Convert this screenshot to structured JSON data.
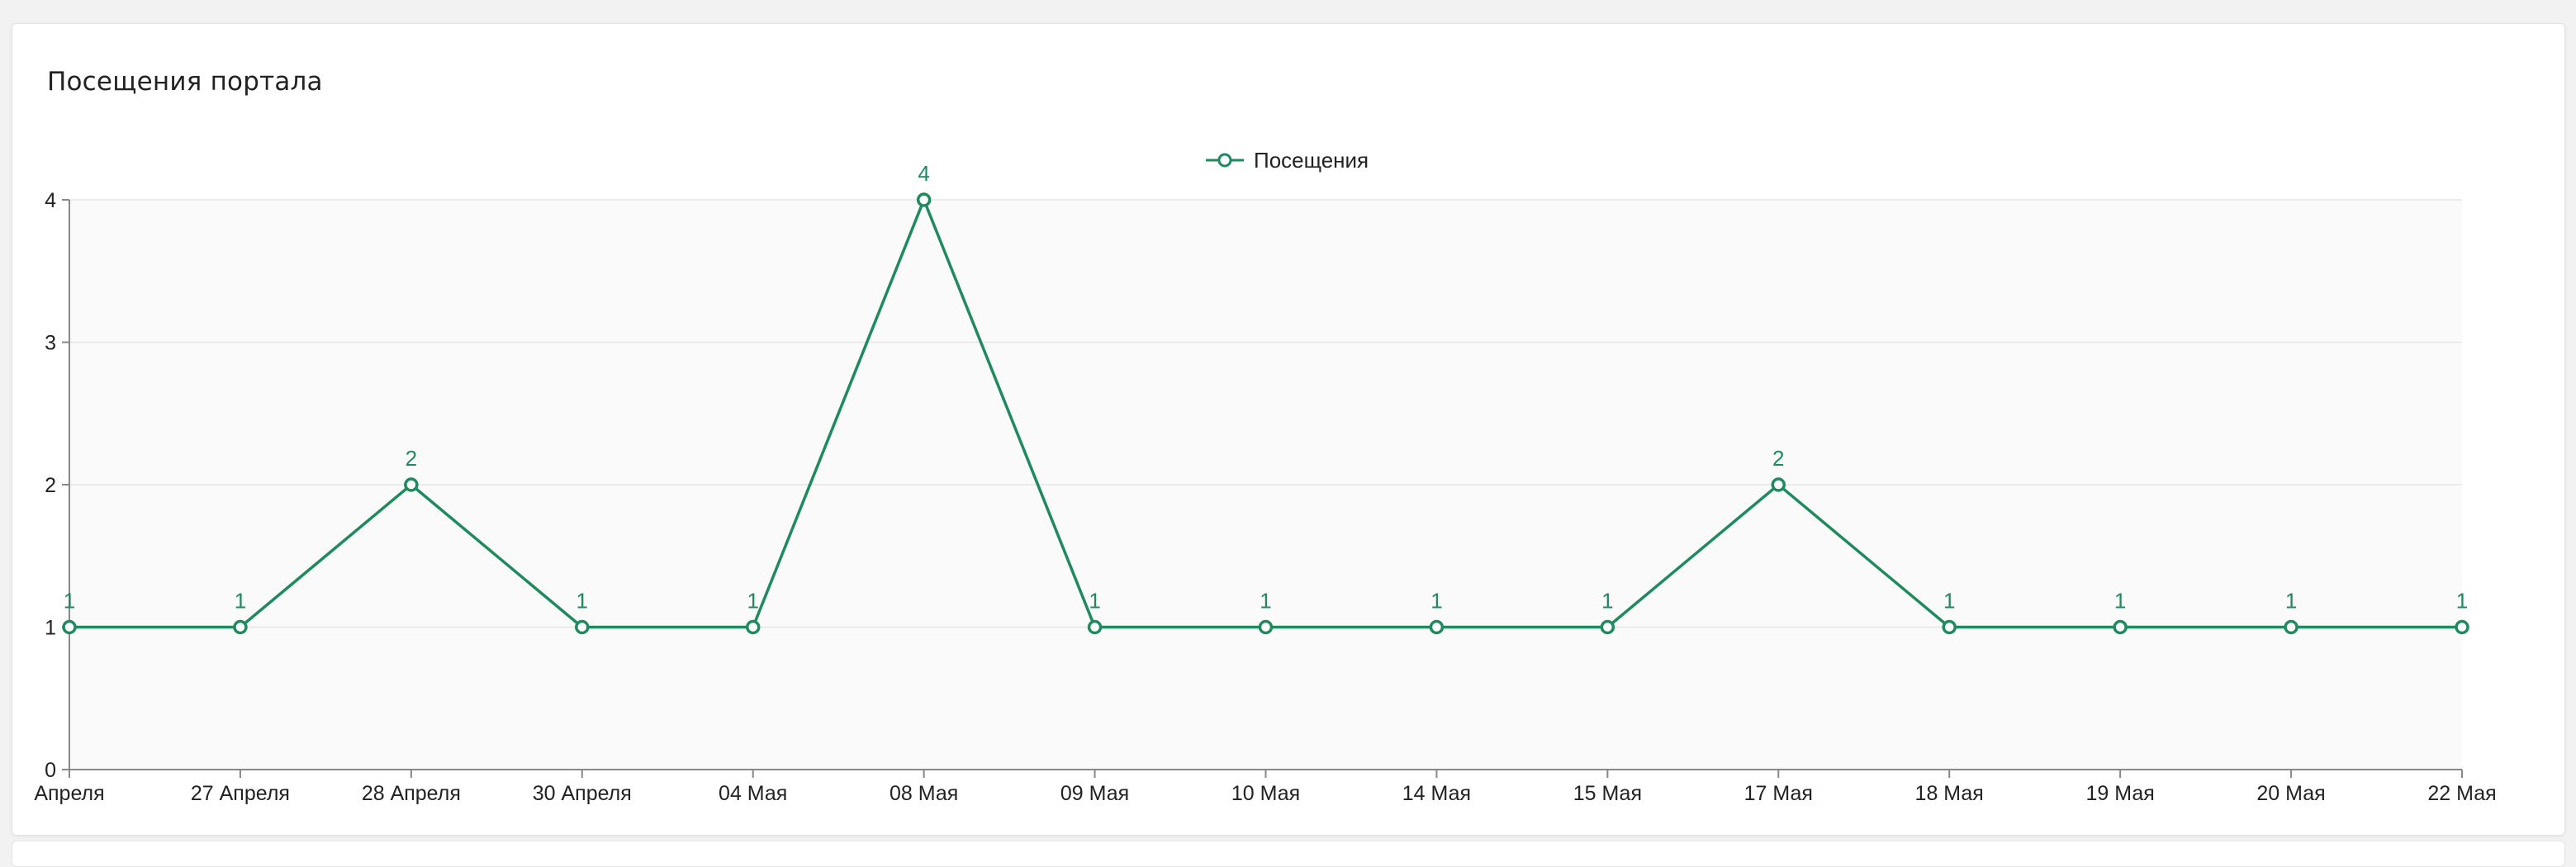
{
  "card": {
    "title": "Посещения портала"
  },
  "colors": {
    "series": "#1e8a5e",
    "plot_background": "#fafafa",
    "grid": "#e6e6e6",
    "axis": "#888888"
  },
  "chart_data": {
    "type": "line",
    "title": "",
    "xlabel": "",
    "ylabel": "",
    "categories": [
      "Апреля",
      "27 Апреля",
      "28 Апреля",
      "30 Апреля",
      "04 Мая",
      "08 Мая",
      "09 Мая",
      "10 Мая",
      "14 Мая",
      "15 Мая",
      "17 Мая",
      "18 Мая",
      "19 Мая",
      "20 Мая",
      "22 Мая"
    ],
    "series": [
      {
        "name": "Посещения",
        "values": [
          1,
          1,
          2,
          1,
          1,
          4,
          1,
          1,
          1,
          1,
          2,
          1,
          1,
          1,
          1
        ],
        "marker": "hollow-circle",
        "data_labels": true
      }
    ],
    "ylim": [
      0,
      4
    ],
    "yticks": [
      0,
      1,
      2,
      3,
      4
    ],
    "grid": true,
    "legend": {
      "position": "top-center",
      "entries": [
        "Посещения"
      ]
    }
  }
}
